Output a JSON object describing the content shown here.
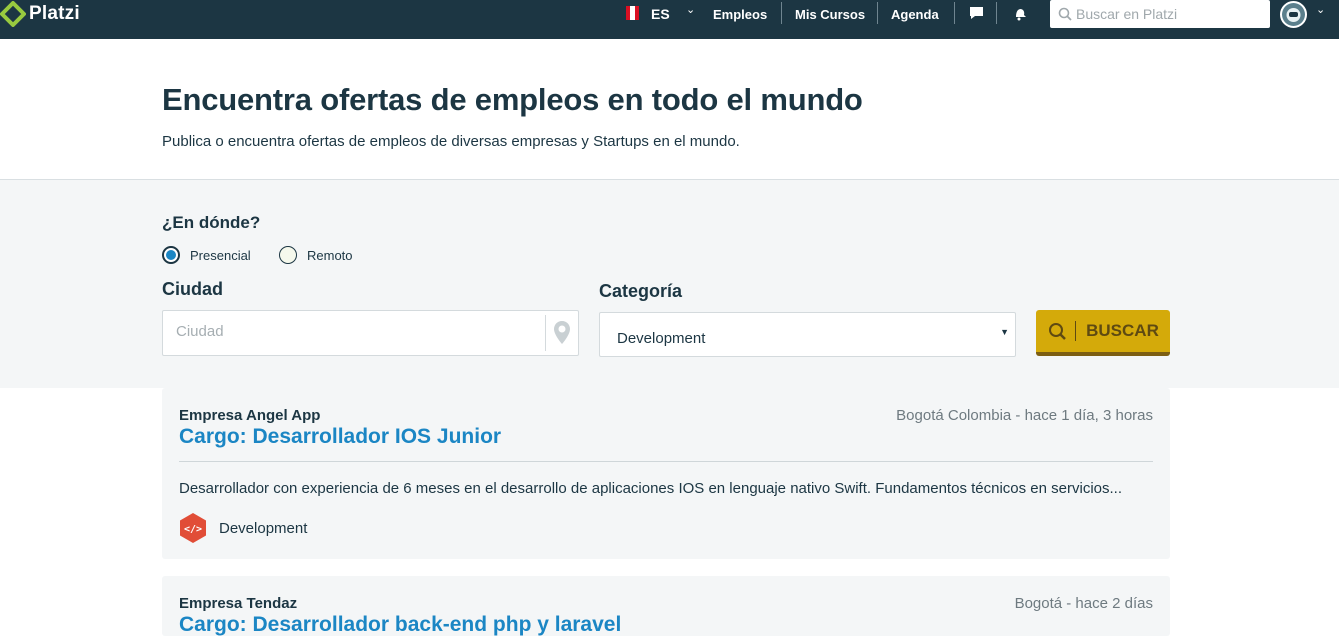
{
  "brand": {
    "name": "Platzi",
    "logo_color": "#98ca3f"
  },
  "nav": {
    "language": "ES",
    "links": [
      "Empleos",
      "Mis Cursos",
      "Agenda"
    ],
    "search_placeholder": "Buscar en Platzi"
  },
  "hero": {
    "title": "Encuentra ofertas de empleos en todo el mundo",
    "subtitle": "Publica o encuentra ofertas de empleos de diversas empresas y Startups en el mundo."
  },
  "filter": {
    "where_label": "¿En dónde?",
    "options": [
      {
        "label": "Presencial",
        "selected": true
      },
      {
        "label": "Remoto",
        "selected": false
      }
    ],
    "city_label": "Ciudad",
    "city_placeholder": "Ciudad",
    "category_label": "Categoría",
    "category_value": "Development",
    "search_button": "BUSCAR",
    "button_color": "#d4aa0a"
  },
  "jobs": [
    {
      "company": "Empresa Angel App",
      "meta": "Bogotá Colombia - hace 1 día, 3 horas",
      "title": "Cargo: Desarrollador IOS Junior",
      "description": "Desarrollador con experiencia de 6 meses en el desarrollo de aplicaciones IOS en lenguaje nativo Swift. Fundamentos técnicos en servicios...",
      "category": "Development",
      "category_icon": "code-icon",
      "category_color": "#e14d37"
    },
    {
      "company": "Empresa Tendaz",
      "meta": "Bogotá - hace 2 días",
      "title": "Cargo: Desarrollador back-end php y laravel"
    }
  ],
  "colors": {
    "nav_bg": "#1c3643",
    "link_blue": "#1b86c4",
    "panel_bg": "#f4f6f7"
  }
}
